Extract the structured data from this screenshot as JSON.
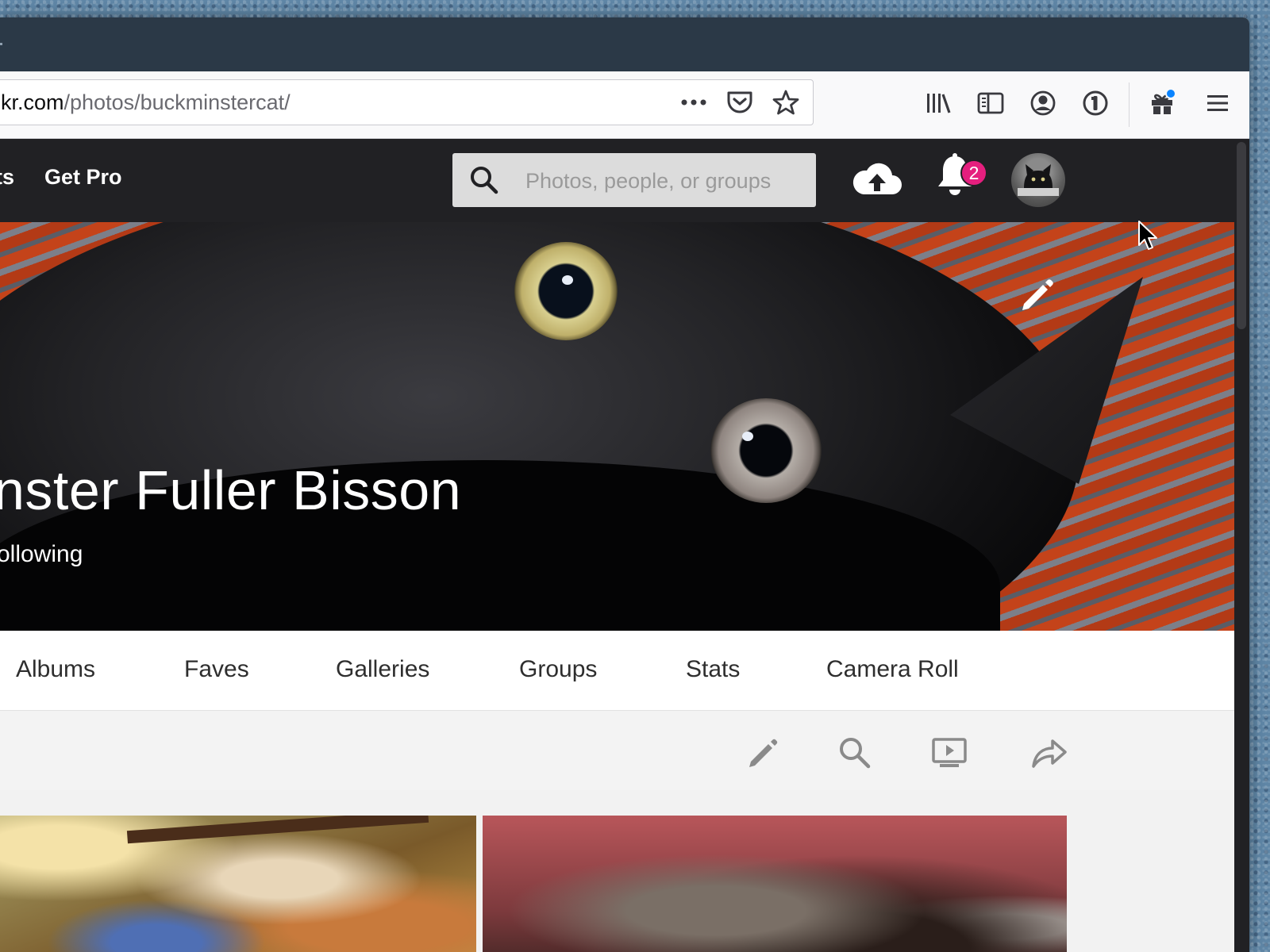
{
  "browser": {
    "url": {
      "domain": "kr.com",
      "path": "/photos/buckminstercat/"
    }
  },
  "site": {
    "nav": {
      "partial_item": "ts",
      "get_pro": "Get Pro"
    },
    "search": {
      "placeholder": "Photos, people, or groups"
    },
    "notifications": {
      "count": "2"
    }
  },
  "profile": {
    "name": "nster Fuller Bisson",
    "following": "ollowing"
  },
  "subnav": {
    "tabs": [
      {
        "label": "Albums"
      },
      {
        "label": "Faves"
      },
      {
        "label": "Galleries"
      },
      {
        "label": "Groups"
      },
      {
        "label": "Stats"
      },
      {
        "label": "Camera Roll"
      }
    ]
  },
  "colors": {
    "header_bg": "#212124",
    "badge": "#e51f7e",
    "titlebar": "#2b3947"
  }
}
